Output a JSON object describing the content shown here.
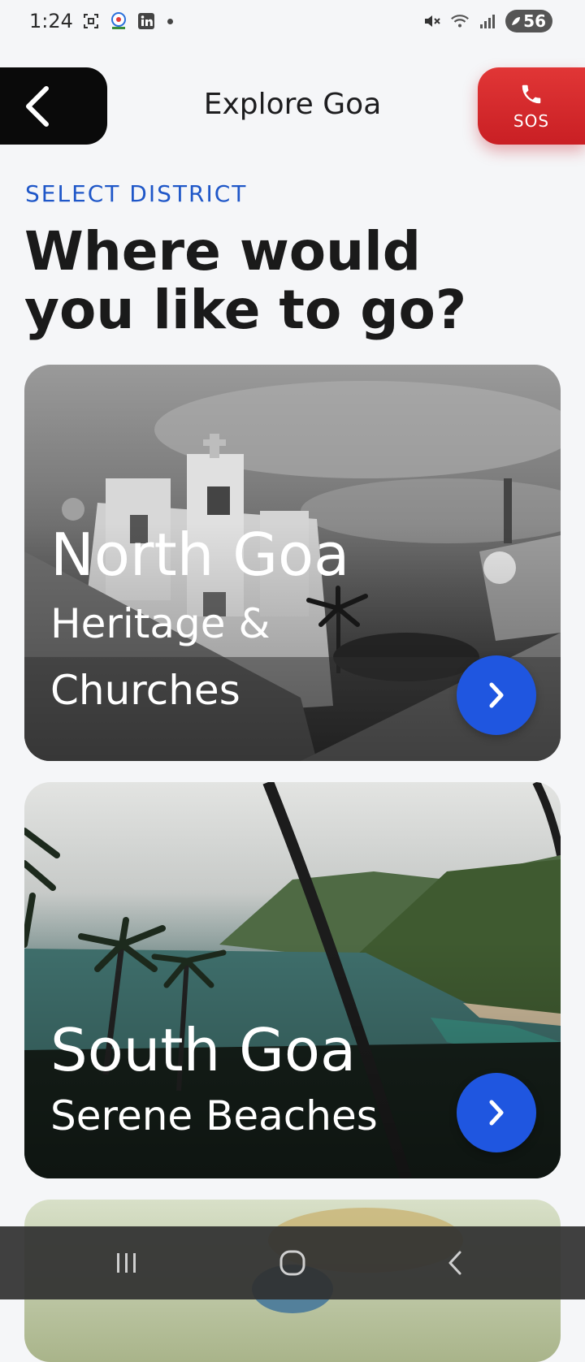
{
  "status_bar": {
    "time": "1:24",
    "battery": "56",
    "left_icons": [
      "screenshot-icon",
      "app-icon",
      "linkedin-icon",
      "dot-icon"
    ],
    "right_icons": [
      "mute-icon",
      "wifi-icon",
      "signal-icon",
      "battery-icon"
    ]
  },
  "header": {
    "title": "Explore Goa",
    "back_icon": "chevron-left-icon",
    "sos_label": "SOS",
    "sos_icon": "phone-icon"
  },
  "section": {
    "eyebrow": "SELECT DISTRICT",
    "title": "Where would you like to go?"
  },
  "cards": [
    {
      "title": "North Goa",
      "subtitle": "Heritage & Churches",
      "icon": "chevron-right-icon"
    },
    {
      "title": "South Goa",
      "subtitle": "Serene Beaches",
      "icon": "chevron-right-icon"
    }
  ],
  "nav": {
    "buttons": [
      "recents-icon",
      "home-icon",
      "back-icon"
    ]
  },
  "colors": {
    "accent": "#1f56e0",
    "sos": "#d92b2f",
    "eyebrow": "#1f57c8"
  }
}
